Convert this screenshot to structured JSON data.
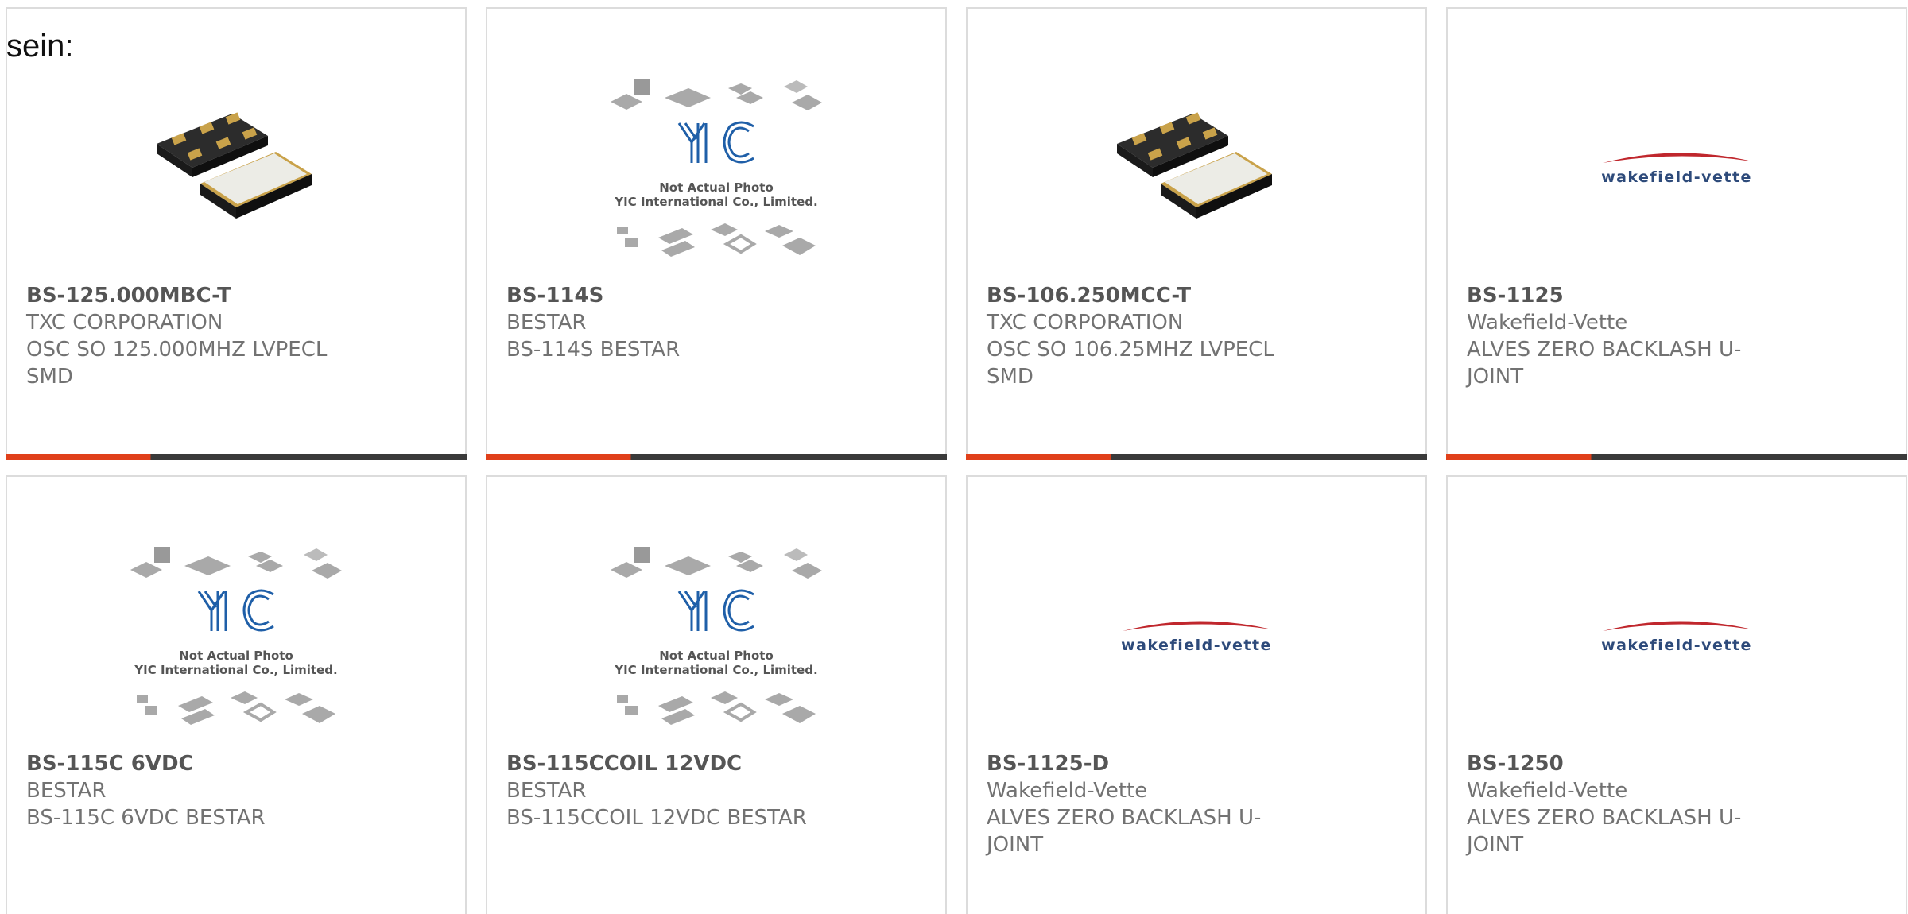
{
  "lead_text": "sein:",
  "colors": {
    "accent": "#e0401a",
    "bar_dark": "#3a3a3a",
    "border": "#dcdcdc",
    "text": "#727272"
  },
  "products": [
    {
      "part_number": "BS-125.000MBC-T",
      "manufacturer": "TXC CORPORATION",
      "description": "OSC SO 125.000MHZ LVPECL SMD",
      "image": "oscillator-smd-photo"
    },
    {
      "part_number": "BS-114S",
      "manufacturer": "BESTAR",
      "description": "BS-114S BESTAR",
      "image": "yic-placeholder-photo",
      "image_caption_1": "Not Actual Photo",
      "image_caption_2": "YIC International Co., Limited.",
      "image_logo": "YIC"
    },
    {
      "part_number": "BS-106.250MCC-T",
      "manufacturer": "TXC CORPORATION",
      "description": "OSC SO 106.25MHZ LVPECL SMD",
      "image": "oscillator-smd-photo"
    },
    {
      "part_number": "BS-1125",
      "manufacturer": "Wakefield-Vette",
      "description": "ALVES ZERO BACKLASH U-JOINT",
      "image": "wakefield-vette-logo",
      "image_logo": "wakefield-vette"
    },
    {
      "part_number": "BS-115C 6VDC",
      "manufacturer": "BESTAR",
      "description": "BS-115C 6VDC BESTAR",
      "image": "yic-placeholder-photo",
      "image_caption_1": "Not Actual Photo",
      "image_caption_2": "YIC International Co., Limited.",
      "image_logo": "YIC"
    },
    {
      "part_number": "BS-115CCOIL 12VDC",
      "manufacturer": "BESTAR",
      "description": "BS-115CCOIL 12VDC BESTAR",
      "image": "yic-placeholder-photo",
      "image_caption_1": "Not Actual Photo",
      "image_caption_2": "YIC International Co., Limited.",
      "image_logo": "YIC"
    },
    {
      "part_number": "BS-1125-D",
      "manufacturer": "Wakefield-Vette",
      "description": "ALVES ZERO BACKLASH U-JOINT",
      "image": "wakefield-vette-logo",
      "image_logo": "wakefield-vette"
    },
    {
      "part_number": "BS-1250",
      "manufacturer": "Wakefield-Vette",
      "description": "ALVES ZERO BACKLASH U-JOINT",
      "image": "wakefield-vette-logo",
      "image_logo": "wakefield-vette"
    }
  ]
}
